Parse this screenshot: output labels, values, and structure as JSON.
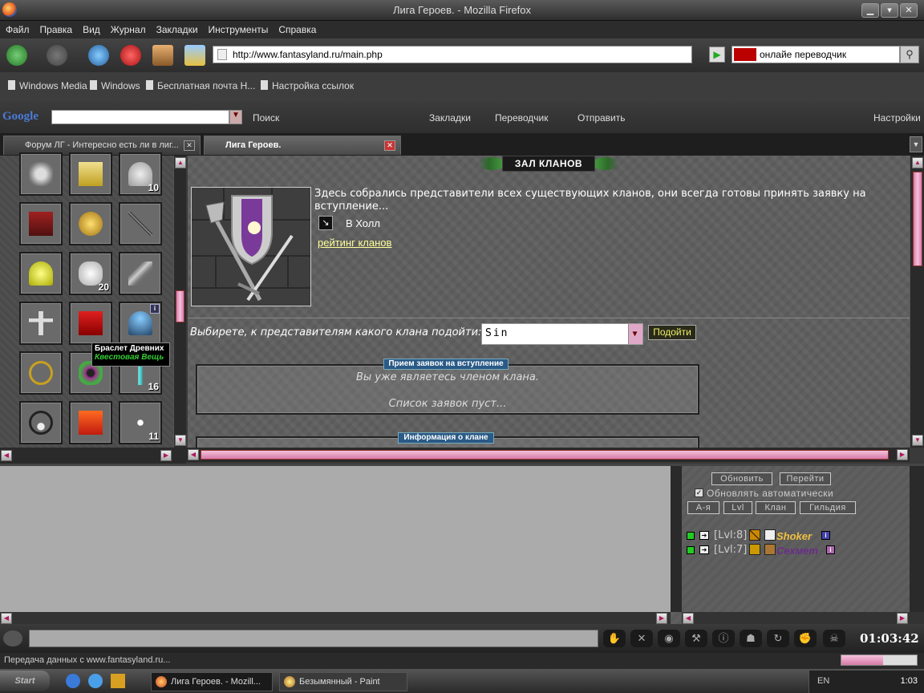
{
  "window": {
    "title": "Лига Героев. - Mozilla Firefox"
  },
  "menu": [
    "Файл",
    "Правка",
    "Вид",
    "Журнал",
    "Закладки",
    "Инструменты",
    "Справка"
  ],
  "nav": {
    "url": "http://www.fantasyland.ru/main.php",
    "search_value": "онлайе переводчик"
  },
  "bookmarks": [
    "Windows Media",
    "Windows",
    "Бесплатная почта Н...",
    "Настройка ссылок"
  ],
  "google_bar": {
    "logo": "Google",
    "search_label": "Поиск",
    "bookmarks_label": "Закладки",
    "translator_label": "Переводчик",
    "send_label": "Отправить",
    "settings_label": "Настройки"
  },
  "tabs": [
    {
      "label": "Форум ЛГ - Интересно есть ли в лиг..."
    },
    {
      "label": "Лига Героев."
    }
  ],
  "inventory": {
    "counts": [
      "10",
      "20",
      "16",
      "11"
    ],
    "tooltip": {
      "name": "Браслет Древних",
      "type": "Квестовая Вещь"
    }
  },
  "hall": {
    "title": "ЗАЛ КЛАНОВ",
    "description": "Здесь собрались представители всех существующих кланов, они всегда готовы принять заявку на вступление...",
    "hall_link": "В Холл",
    "rating_link": "рейтинг кланов",
    "choose_label": "Выбирете, к представителям какого клана подойти:",
    "selected_clan": "Sin",
    "go_button": "Подойти",
    "applications": {
      "header": "Прием заявок на вступление",
      "line1": "Вы уже являетесь членом клана.",
      "line2": "Список заявок пуст..."
    },
    "clan_info_header": "Информация о клане"
  },
  "online_panel": {
    "refresh_button": "Обновить",
    "goto_button": "Перейти",
    "auto_refresh_label": "Обновлять автоматически",
    "sort_buttons": [
      "А-я",
      "Lvl",
      "Клан",
      "Гильдия"
    ],
    "users": [
      {
        "level": "[Lvl:8]",
        "name": "Shoker",
        "color": "#f0c040"
      },
      {
        "level": "[Lvl:7]",
        "name": "Сехмет",
        "color": "#6a2c8a"
      }
    ]
  },
  "toolbar": {
    "clock": "01:03:42"
  },
  "status": {
    "text": "Передача данных с www.fantasyland.ru...",
    "progress": 0.55
  },
  "taskbar": {
    "start": "Start",
    "tasks": [
      "Лига Героев. - Mozill...",
      "Безымянный - Paint"
    ],
    "lang": "EN",
    "time": "1:03"
  }
}
